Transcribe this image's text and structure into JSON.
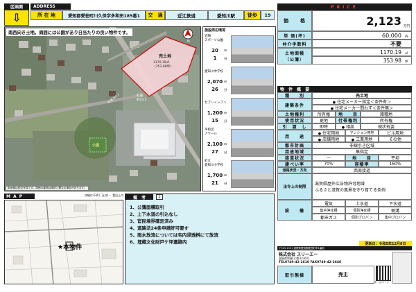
{
  "header": {
    "kuiki_label": "区画図",
    "address_en": "ADDRESS",
    "shozaichi_label": "所 在 地",
    "address": "愛知郡愛荘町川久保字多和田185番1",
    "kotsu_label": "交　通",
    "railway": "近江鉄道",
    "station": "愛知川駅",
    "toho_label": "徒歩",
    "walk_minutes": "19",
    "price_en": "PRICE"
  },
  "aerial": {
    "caption": "南西向き土地。周囲には公園があり日当たりの良い物件です。",
    "land_label": "売土地",
    "land_area": "1170.19㎡",
    "land_tsubo": "(353.98坪)",
    "road_label": "町道",
    "road_width": "約20.5",
    "road_label2": "町道 約4.2",
    "park_label": "公園",
    "north": "N",
    "copyright": "本画像は航空写真です。周囲の建物は現況と異なる場合があります。"
  },
  "surroundings": {
    "title": "施設周辺環境",
    "items": [
      {
        "name": "スポーツ公園",
        "sub": "近隣",
        "dist": "20",
        "min": "1"
      },
      {
        "name": "愛知川中学校",
        "sub": "",
        "dist": "2,070",
        "min": "26"
      },
      {
        "name": "セブンイレブン",
        "sub": "",
        "dist": "1,200",
        "min": "15"
      },
      {
        "name": "アヤール",
        "sub": "平和堂",
        "dist": "2,100",
        "min": "27"
      },
      {
        "name": "愛知川小学校",
        "sub": "町立",
        "dist": "1,700",
        "min": "21"
      }
    ],
    "unit_m": "m",
    "unit_min": "分"
  },
  "price": {
    "label": "価　　格",
    "value": "2,123",
    "unit": "万円",
    "tsubo_label": "単 価(坪)",
    "tsubo_value": "60,000",
    "tsubo_unit": "円",
    "fee_label": "仲介手数料",
    "fee_value": "不要",
    "land_area_label": "土地面積",
    "koubo_label": "（公簿）",
    "area_sqm": "1170.19",
    "area_sqm_unit": "㎡",
    "area_tsubo": "353.98",
    "area_tsubo_unit": "坪"
  },
  "overview": {
    "title": "物 件 概 要",
    "shubetsu_label": "種　　別",
    "shubetsu_value": "売土地",
    "kenchiku_label": "建築条件",
    "kenchiku_opt1": "住宅メーカー指定＜条件有＞",
    "kenchiku_opt2": "住宅メーカー問わず＜条件無＞",
    "tochikenri_label": "土地権利",
    "tochikenri_v1": "所有権",
    "chimoku_label": "地　　目",
    "chimoku_v": "雑種地",
    "shiyou_label": "使用状況",
    "shiyou_v": "更地",
    "futai_label": "付帯権利",
    "futai_v": "所有権",
    "hikiwatashi_label": "引　渡　し",
    "hikiwatashi_v1": "即時",
    "hikiwatashi_v2": "相談",
    "hikiwatashi_v3": "現状有姿",
    "youto_label": "用　　途",
    "youto_v": [
      "住宅用地",
      "マンション用地",
      "ビル用地",
      "店舗用地",
      "工業用地",
      "その他"
    ],
    "toshi_label": "都市計画",
    "toshi_v": "非線引き区域",
    "youtochiiki_label": "用途地域",
    "youtochiiki_v": "無指定",
    "kenpei_label": "建ぺい率",
    "kenpei_v": "70%",
    "youseki_label": "容積率",
    "youseki_v": "160%",
    "setsudo_label": "道路状況・方向",
    "setsudo_v": "西南接道",
    "kokudo_label": "接道状況",
    "kokudo_v1": "—",
    "kokudo_v2": "平坦",
    "hourei_label": "法令上の制限",
    "hourei_v1": "滋賀県屋外広告物許可地域",
    "hourei_v2": "ふるさと滋賀の風景を守り育てる条例",
    "setsubi_label": "設　　備",
    "setsubi": [
      [
        "電気",
        "上水道",
        "下水道"
      ],
      [
        "集中浄化槽",
        "個別浄化槽",
        "側溝"
      ],
      [
        "都市ガス",
        "個別プロパン",
        "集中プロパン"
      ]
    ]
  },
  "map": {
    "label": "M A P",
    "marker": "★本物件",
    "note": "詳細は不明 [ ]土地 ・ 登記上の"
  },
  "biko": {
    "label": "備　考",
    "num": "2",
    "items": [
      "1、公簿面積取引",
      "2、上下水道の引込なし",
      "3、官民境界確定済み",
      "4、道路法24条申請許可要す",
      "5、雨水放流については宅内浸透桝にて放流",
      "6、埋蔵文化財戸ケ坪遺跡内"
    ]
  },
  "company": {
    "update": "更新日：令和5年12月8日",
    "license": "滋賀県知事(2)第3236号",
    "name": "株式会社 スリーエー",
    "tel": "TEL0749-42-2610 FAX0749-42-2640",
    "torihiki": "取引態様",
    "torihiki_v": "売主",
    "qr_caption": "ホームページ",
    "prefix": "〒529-1331 滋賀県愛知郡愛荘町市1番地"
  }
}
